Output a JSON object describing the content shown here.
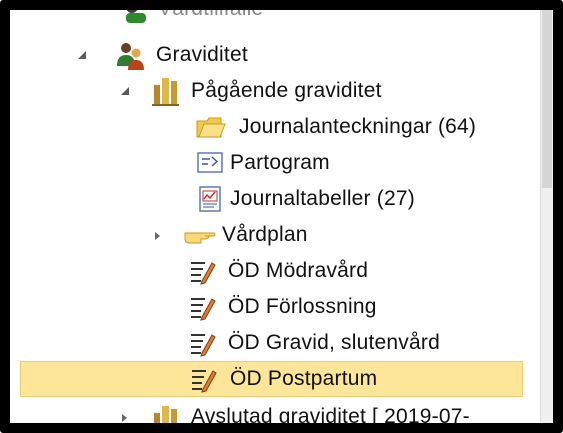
{
  "tree": {
    "partial_top_label": "Vårdtillfälle",
    "graviditet": "Graviditet",
    "pagaende": "Pågående graviditet",
    "journalanteckningar": "Journalanteckningar (64)",
    "partogram": "Partogram",
    "journaltabeller": "Journaltabeller (27)",
    "vardplan": "Vårdplan",
    "od_modravard": "ÖD Mödravård",
    "od_forlossning": "ÖD Förlossning",
    "od_gravid_slutenvard": "ÖD Gravid, slutenvård",
    "od_postpartum": "ÖD Postpartum",
    "avslutad": "Avslutad graviditet [ 2019-07-"
  },
  "colors": {
    "selection_bg": "#fde59a",
    "selection_border": "#f1cd70",
    "frame": "#000000"
  },
  "icons": {
    "graviditet": "people-icon",
    "pagaende": "binder-icon",
    "journalanteckningar": "folder-notes-icon",
    "partogram": "partogram-icon",
    "journaltabeller": "table-chart-icon",
    "vardplan": "hand-icon",
    "od": "edit-document-icon",
    "avslutad": "binder-icon"
  }
}
